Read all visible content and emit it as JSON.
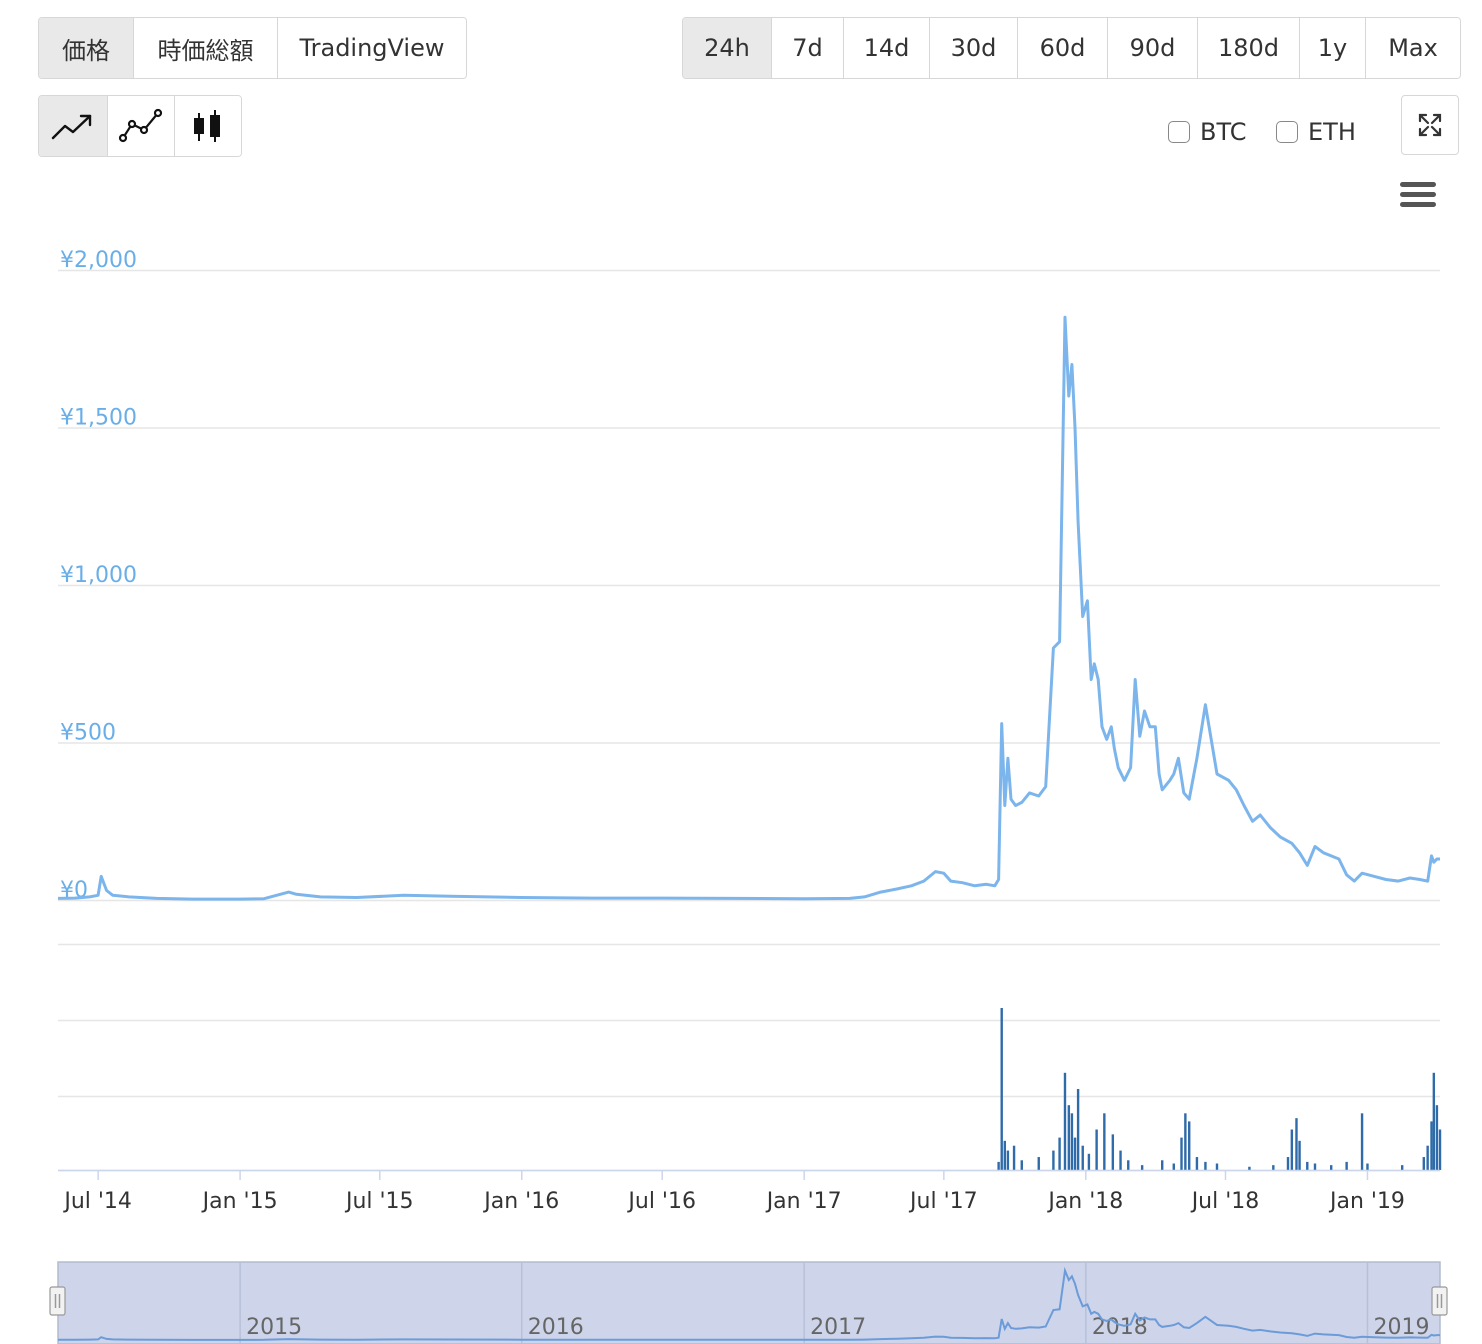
{
  "toolbar": {
    "metric_tabs": [
      {
        "label": "価格",
        "active": true
      },
      {
        "label": "時価総額",
        "active": false
      },
      {
        "label": "TradingView",
        "active": false
      }
    ],
    "range_tabs": [
      {
        "label": "24h",
        "active": true
      },
      {
        "label": "7d",
        "active": false
      },
      {
        "label": "14d",
        "active": false
      },
      {
        "label": "30d",
        "active": false
      },
      {
        "label": "60d",
        "active": false
      },
      {
        "label": "90d",
        "active": false
      },
      {
        "label": "180d",
        "active": false
      },
      {
        "label": "1y",
        "active": false
      },
      {
        "label": "Max",
        "active": false
      }
    ],
    "chart_type_buttons": [
      {
        "icon": "line-chart-icon",
        "active": true
      },
      {
        "icon": "point-line-chart-icon",
        "active": false
      },
      {
        "icon": "candlestick-icon",
        "active": false
      }
    ],
    "compare": [
      {
        "label": "BTC",
        "checked": false
      },
      {
        "label": "ETH",
        "checked": false
      }
    ],
    "fullscreen_icon": "expand-icon",
    "menu_icon": "hamburger-menu-icon"
  },
  "chart_data": {
    "type": "line",
    "title": "",
    "xlabel": "",
    "ylabel": "",
    "y_ticks": [
      0,
      500,
      1000,
      1500,
      2000
    ],
    "y_tick_labels": [
      "¥0",
      "¥500",
      "¥1,000",
      "¥1,500",
      "¥2,000"
    ],
    "ylim": [
      0,
      2000
    ],
    "x_tick_labels": [
      "Jul '14",
      "Jan '15",
      "Jul '15",
      "Jan '16",
      "Jul '16",
      "Jan '17",
      "Jul '17",
      "Jan '18",
      "Jul '18",
      "Jan '19"
    ],
    "x_tick_dates": [
      "2014-07-01",
      "2015-01-01",
      "2015-07-01",
      "2016-01-01",
      "2016-07-01",
      "2017-01-01",
      "2017-07-01",
      "2018-01-01",
      "2018-07-01",
      "2019-01-01"
    ],
    "xlim": [
      "2014-05-10",
      "2019-04-05"
    ],
    "grid": true,
    "colors": {
      "price": "#7cb5ec",
      "volume": "#2f6ba8",
      "tick_label": "#6aaee8",
      "grid": "#e6e6e6",
      "navigator_fill": "#ced5ea"
    },
    "series": [
      {
        "kind": "price",
        "x": [
          "2014-05-10",
          "2014-06-01",
          "2014-06-20",
          "2014-07-01",
          "2014-07-05",
          "2014-07-12",
          "2014-07-20",
          "2014-08-10",
          "2014-09-15",
          "2014-11-01",
          "2015-01-01",
          "2015-02-01",
          "2015-03-05",
          "2015-03-15",
          "2015-04-15",
          "2015-06-01",
          "2015-08-01",
          "2015-10-01",
          "2016-01-01",
          "2016-04-01",
          "2016-07-01",
          "2016-10-01",
          "2017-01-01",
          "2017-03-01",
          "2017-03-20",
          "2017-04-10",
          "2017-05-01",
          "2017-05-20",
          "2017-06-05",
          "2017-06-20",
          "2017-07-01",
          "2017-07-10",
          "2017-07-25",
          "2017-08-10",
          "2017-08-25",
          "2017-09-05",
          "2017-09-10",
          "2017-09-14",
          "2017-09-18",
          "2017-09-22",
          "2017-09-26",
          "2017-10-02",
          "2017-10-10",
          "2017-10-20",
          "2017-11-01",
          "2017-11-10",
          "2017-11-20",
          "2017-11-28",
          "2017-12-05",
          "2017-12-10",
          "2017-12-14",
          "2017-12-18",
          "2017-12-22",
          "2017-12-28",
          "2018-01-03",
          "2018-01-08",
          "2018-01-12",
          "2018-01-17",
          "2018-01-22",
          "2018-01-28",
          "2018-02-03",
          "2018-02-07",
          "2018-02-12",
          "2018-02-20",
          "2018-02-28",
          "2018-03-06",
          "2018-03-12",
          "2018-03-18",
          "2018-03-25",
          "2018-04-01",
          "2018-04-06",
          "2018-04-10",
          "2018-04-20",
          "2018-04-25",
          "2018-05-01",
          "2018-05-08",
          "2018-05-15",
          "2018-05-25",
          "2018-06-05",
          "2018-06-20",
          "2018-07-05",
          "2018-07-15",
          "2018-07-25",
          "2018-08-05",
          "2018-08-15",
          "2018-08-28",
          "2018-09-10",
          "2018-09-25",
          "2018-10-05",
          "2018-10-15",
          "2018-10-25",
          "2018-11-05",
          "2018-11-15",
          "2018-11-25",
          "2018-12-05",
          "2018-12-15",
          "2018-12-25",
          "2019-01-10",
          "2019-01-25",
          "2019-02-10",
          "2019-02-25",
          "2019-03-10",
          "2019-03-20",
          "2019-03-25",
          "2019-03-28",
          "2019-04-01",
          "2019-04-05"
        ],
        "values": [
          5,
          6,
          10,
          15,
          75,
          30,
          15,
          10,
          5,
          3,
          3,
          4,
          25,
          18,
          10,
          8,
          15,
          12,
          8,
          6,
          6,
          5,
          4,
          5,
          10,
          25,
          35,
          45,
          60,
          90,
          85,
          60,
          55,
          45,
          50,
          45,
          65,
          560,
          300,
          450,
          320,
          300,
          310,
          340,
          330,
          360,
          800,
          820,
          1850,
          1600,
          1700,
          1500,
          1200,
          900,
          950,
          700,
          750,
          700,
          550,
          510,
          550,
          480,
          420,
          380,
          420,
          700,
          520,
          600,
          550,
          550,
          400,
          350,
          380,
          400,
          450,
          340,
          320,
          450,
          620,
          400,
          380,
          350,
          300,
          250,
          270,
          230,
          200,
          180,
          150,
          110,
          170,
          150,
          140,
          130,
          80,
          60,
          85,
          75,
          65,
          60,
          70,
          65,
          60,
          140,
          120,
          130,
          130
        ]
      },
      {
        "kind": "volume",
        "x": [
          "2017-09-10",
          "2017-09-14",
          "2017-09-18",
          "2017-09-22",
          "2017-09-30",
          "2017-10-10",
          "2017-11-01",
          "2017-11-20",
          "2017-11-28",
          "2017-12-05",
          "2017-12-10",
          "2017-12-14",
          "2017-12-18",
          "2017-12-22",
          "2017-12-28",
          "2018-01-05",
          "2018-01-15",
          "2018-01-25",
          "2018-02-05",
          "2018-02-15",
          "2018-02-25",
          "2018-03-15",
          "2018-04-10",
          "2018-04-25",
          "2018-05-05",
          "2018-05-10",
          "2018-05-15",
          "2018-05-25",
          "2018-06-05",
          "2018-06-20",
          "2018-08-01",
          "2018-09-01",
          "2018-09-20",
          "2018-09-25",
          "2018-10-01",
          "2018-10-05",
          "2018-10-15",
          "2018-10-25",
          "2018-11-15",
          "2018-12-05",
          "2018-12-25",
          "2019-01-01",
          "2019-02-15",
          "2019-03-15",
          "2019-03-20",
          "2019-03-25",
          "2019-03-28",
          "2019-04-01",
          "2019-04-05"
        ],
        "values": [
          5,
          100,
          18,
          12,
          15,
          6,
          8,
          12,
          20,
          60,
          40,
          35,
          20,
          50,
          15,
          10,
          25,
          35,
          22,
          12,
          6,
          3,
          6,
          4,
          20,
          35,
          30,
          8,
          5,
          4,
          2,
          3,
          8,
          25,
          32,
          18,
          5,
          4,
          3,
          5,
          35,
          4,
          3,
          8,
          15,
          30,
          60,
          40,
          25
        ]
      }
    ],
    "navigator": {
      "year_labels": [
        "2015",
        "2016",
        "2017",
        "2018",
        "2019"
      ],
      "year_dates": [
        "2015-01-01",
        "2016-01-01",
        "2017-01-01",
        "2018-01-01",
        "2019-01-01"
      ]
    }
  }
}
